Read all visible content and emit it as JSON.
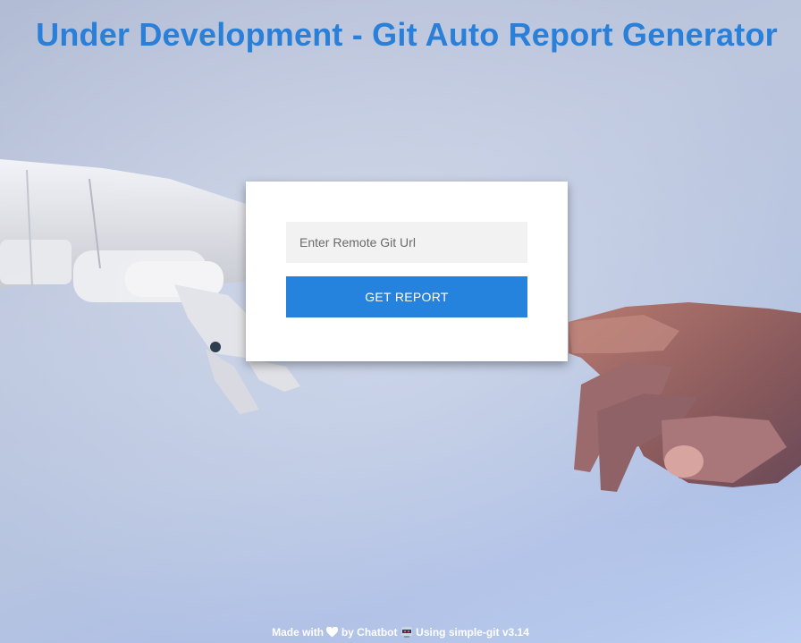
{
  "header": {
    "title": "Under Development - Git Auto Report Generator"
  },
  "form": {
    "url_placeholder": "Enter Remote Git Url",
    "url_value": "",
    "submit_label": "GET REPORT"
  },
  "footer": {
    "made_with": "Made with",
    "by_text": "by Chatbot",
    "using_text": "Using simple-git v3.14",
    "heart_icon": "heart-icon",
    "robot_icon": "robot-icon"
  },
  "background": {
    "image": "robot-hand-and-human-hand-photo"
  },
  "colors": {
    "title": "#2a7fd8",
    "button": "#2582dd",
    "input_bg": "#f2f2f2",
    "card_bg": "#ffffff",
    "footer_text": "#ffffff"
  }
}
